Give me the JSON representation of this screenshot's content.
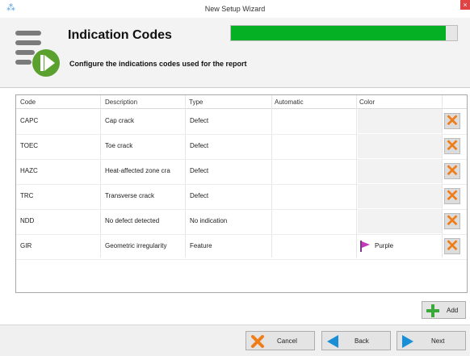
{
  "window": {
    "title": "New Setup Wizard",
    "close_glyph": "×"
  },
  "header": {
    "title": "Indication Codes",
    "subtitle": "Configure the indications codes used for the report",
    "progress_fraction": 0.95,
    "progress_color": "#06b025"
  },
  "table": {
    "columns": [
      "Code",
      "Description",
      "Type",
      "Automatic",
      "Color"
    ],
    "rows": [
      {
        "code": "CAPC",
        "description": "Cap crack",
        "type": "Defect",
        "automatic": "",
        "color": ""
      },
      {
        "code": "TOEC",
        "description": "Toe crack",
        "type": "Defect",
        "automatic": "",
        "color": ""
      },
      {
        "code": "HAZC",
        "description": "Heat-affected zone cra",
        "type": "Defect",
        "automatic": "",
        "color": ""
      },
      {
        "code": "TRC",
        "description": "Transverse crack",
        "type": "Defect",
        "automatic": "",
        "color": ""
      },
      {
        "code": "NDD",
        "description": "No defect detected",
        "type": "No indication",
        "automatic": "",
        "color": ""
      },
      {
        "code": "GIR",
        "description": "Geometric irregularity",
        "type": "Feature",
        "automatic": "",
        "color": "Purple"
      }
    ],
    "delete_glyph": "✕"
  },
  "buttons": {
    "add": "Add",
    "cancel": "Cancel",
    "back": "Back",
    "next": "Next"
  },
  "colors": {
    "accent_orange": "#f07d18",
    "accent_blue": "#1a8fd8",
    "accent_green": "#3aa83a",
    "flag_purple": "#c23ab8"
  }
}
